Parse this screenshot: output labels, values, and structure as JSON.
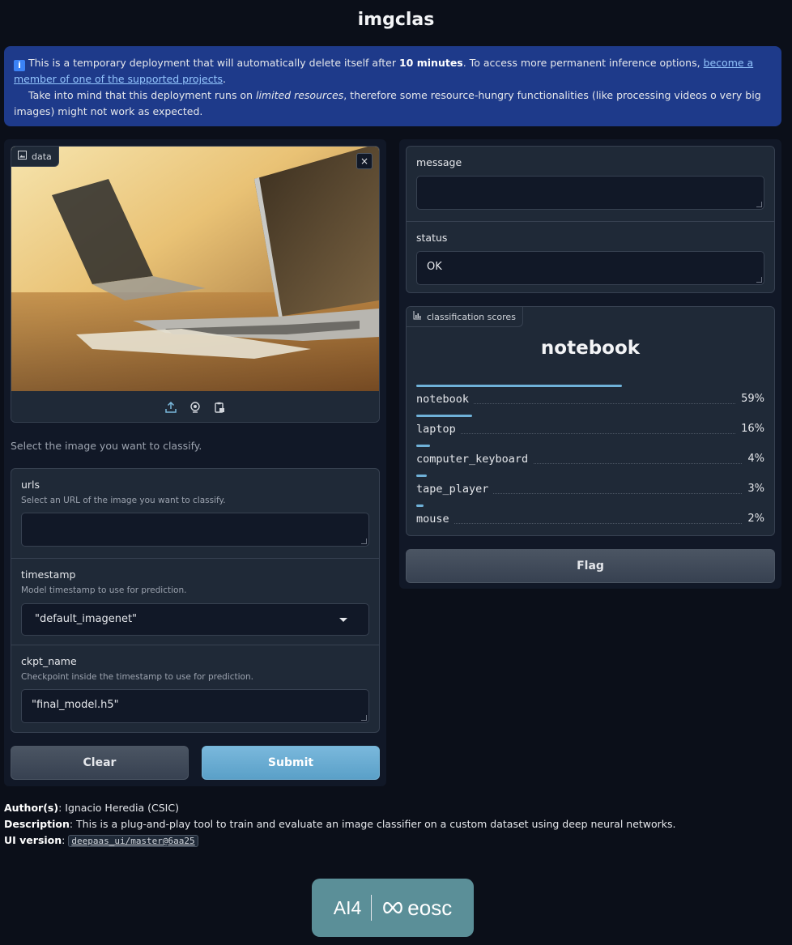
{
  "app": {
    "title": "imgclas"
  },
  "banner": {
    "text_1": " This is a temporary deployment that will automatically delete itself after ",
    "bold_1": "10 minutes",
    "text_2": ". To access more permanent inference options, ",
    "link": "become a member of one of the supported projects",
    "text_3": ".",
    "text_4": "Take into mind that this deployment runs on ",
    "italic": "limited resources",
    "text_5": ", therefore some resource-hungry functionalities (like processing videos o very big images) might not work as expected."
  },
  "input": {
    "image": {
      "label": "data",
      "close": "×"
    },
    "hint": "Select the image you want to classify.",
    "urls": {
      "label": "urls",
      "info": "Select an URL of the image you want to classify.",
      "value": ""
    },
    "timestamp": {
      "label": "timestamp",
      "info": "Model timestamp to use for prediction.",
      "value": "\"default_imagenet\""
    },
    "ckpt_name": {
      "label": "ckpt_name",
      "info": "Checkpoint inside the timestamp to use for prediction.",
      "value": "\"final_model.h5\""
    },
    "clear_label": "Clear",
    "submit_label": "Submit"
  },
  "output": {
    "message": {
      "label": "message",
      "value": ""
    },
    "status": {
      "label": "status",
      "value": "OK"
    },
    "scores": {
      "label": "classification scores",
      "top": "notebook",
      "items": [
        {
          "name": "notebook",
          "pct": "59%",
          "value": 0.59
        },
        {
          "name": "laptop",
          "pct": "16%",
          "value": 0.16
        },
        {
          "name": "computer_keyboard",
          "pct": "4%",
          "value": 0.04
        },
        {
          "name": "tape_player",
          "pct": "3%",
          "value": 0.03
        },
        {
          "name": "mouse",
          "pct": "2%",
          "value": 0.02
        }
      ]
    },
    "flag_label": "Flag"
  },
  "footer": {
    "author_key": "Author(s)",
    "author_val": ": Ignacio Heredia (CSIC)",
    "desc_key": "Description",
    "desc_val": ": This is a plug-and-play tool to train and evaluate an image classifier on a custom dataset using deep neural networks.",
    "version_key": "UI version",
    "version_sep": ": ",
    "version_val": "deepaas_ui/master@6aa25"
  },
  "logo": {
    "left": "AI4",
    "right": "eosc"
  },
  "colors": {
    "banner": "#1e3a8a",
    "accent": "#6fb1d8",
    "background": "#0b0f19"
  }
}
